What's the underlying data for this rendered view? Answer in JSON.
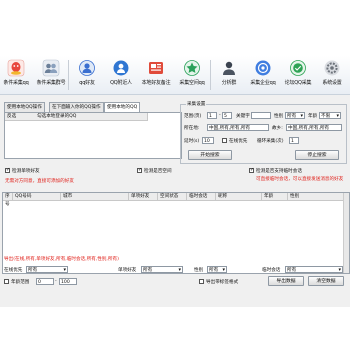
{
  "toolbar": {
    "items": [
      {
        "label": "条件采集qq",
        "icon": "qq-red-icon",
        "color": "#e8463d"
      },
      {
        "label": "条件采集群号",
        "icon": "group-icon",
        "color": "#6b7f99"
      },
      {
        "label": "qq好友",
        "icon": "friends-icon",
        "color": "#3a6fd0"
      },
      {
        "label": "QQ附近人",
        "icon": "nearby-icon",
        "color": "#2f76d2"
      },
      {
        "label": "本地好友备注",
        "icon": "local-friend-icon",
        "color": "#e04b3b"
      },
      {
        "label": "采集空间qq",
        "icon": "qzone-icon",
        "color": "#2aa15a"
      },
      {
        "label": "分析群",
        "icon": "analyze-group-icon",
        "color": "#4a5360"
      },
      {
        "label": "采集企业qq",
        "icon": "enterprise-icon",
        "color": "#3f7de0"
      },
      {
        "label": "论坛QQ采集",
        "icon": "forum-icon",
        "color": "#2ea355"
      },
      {
        "label": "系统设置",
        "icon": "settings-icon",
        "color": "#8b8f96"
      }
    ]
  },
  "tabs": [
    "使用本地QQ操作",
    "在下面输入你的QQ操作",
    "使用本地的QQ"
  ],
  "left_table": {
    "headers": [
      "反选",
      "勾选本地登录的QQ"
    ]
  },
  "settings": {
    "title": "采集设置",
    "range_label": "范围(页)",
    "range_from": "1",
    "range_sep": "-",
    "range_to": "5",
    "keyword_label": "关键字",
    "keyword_value": "",
    "gender_label": "性别",
    "gender_value": "所有",
    "age_label": "年龄",
    "age_value": "不限",
    "region_label": "所在地:",
    "region_value": "中国,所有,所有,所有",
    "hometown_label": "故乡:",
    "hometown_value": "中国,所有,所有,所有",
    "interval_label": "延时(s)",
    "interval_value": "10",
    "online_label": "在线优先",
    "loop_label": "循环采集(次)",
    "loop_value": "1",
    "start_button": "开始搜索",
    "stop_button": "停止搜索"
  },
  "options": {
    "check_single": "检测单项好友",
    "check_qzone": "检测是否空间",
    "check_temp": "检测是否支持临时会话",
    "hint_left": "无需对方同意，直接可添加的好友",
    "hint_right": "可直接临时会话，可以直接发送消息的好友"
  },
  "result_table": {
    "headers": [
      "序号",
      "QQ号码",
      "城市",
      "单项好友",
      "空间状态",
      "临时会话",
      "昵称",
      "年龄",
      "性别"
    ]
  },
  "export_hint": "导出(在线,所有,单项好友,所有,临时会话,所有,性别,所有)",
  "filters": {
    "online_label": "在线优先",
    "online_value": "所有",
    "single_label": "单项好友",
    "single_value": "所有",
    "gender_label": "性别",
    "gender_value": "所有",
    "temp_label": "临时会话",
    "temp_value": "所有",
    "age_label": "年龄范围",
    "age_from": "0",
    "age_to": "100",
    "export_tag_label": "导出带标签格式",
    "export_button": "导出数据",
    "clear_button": "清空数据"
  }
}
